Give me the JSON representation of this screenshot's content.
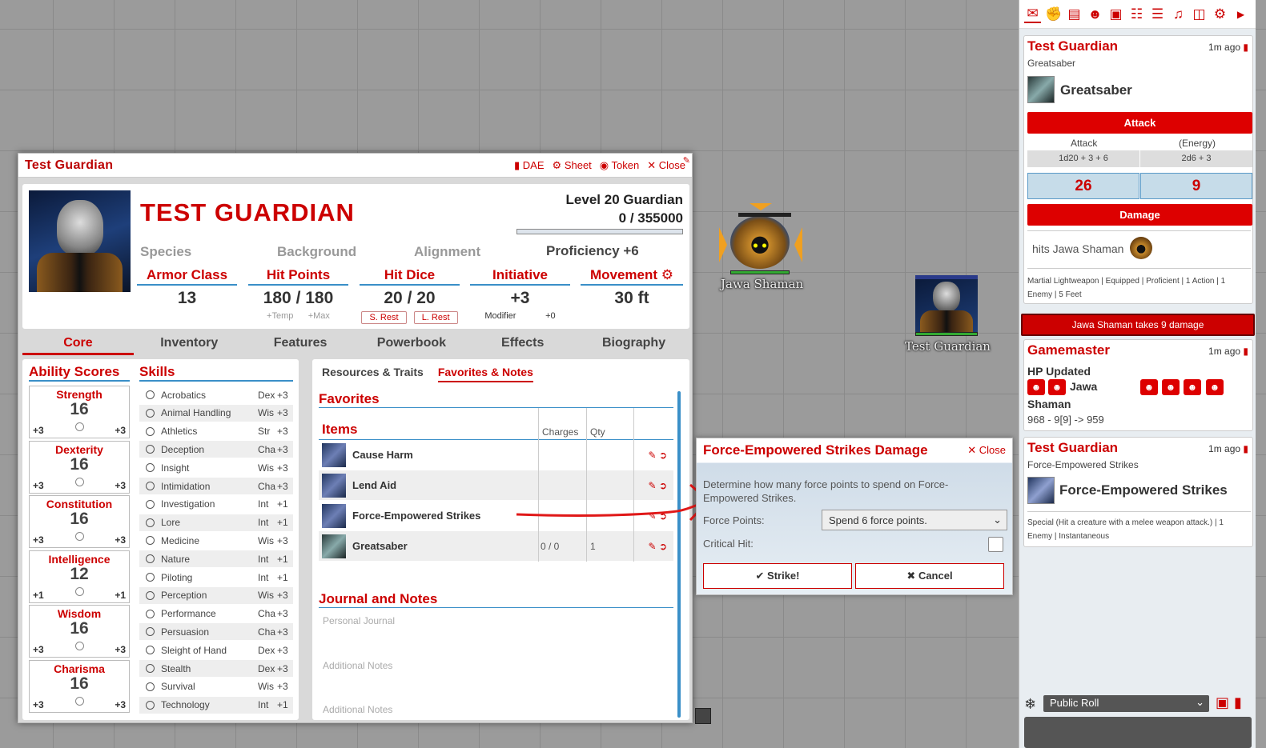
{
  "tokens": {
    "jawa": "Jawa Shaman",
    "guardian": "Test Guardian"
  },
  "sheet": {
    "window_title": "Test Guardian",
    "actions": [
      "DAE",
      "Sheet",
      "Token",
      "Close"
    ],
    "name": "TEST GUARDIAN",
    "level": "Level 20 Guardian",
    "xp": "0  / 355000",
    "species": "Species",
    "background": "Background",
    "alignment": "Alignment",
    "proficiency": "Proficiency +6",
    "stats": {
      "ac": {
        "label": "Armor Class",
        "value": "13"
      },
      "hp": {
        "label": "Hit Points",
        "value": "180 / 180",
        "temp": "+Temp",
        "max": "+Max"
      },
      "hd": {
        "label": "Hit Dice",
        "value": "20 / 20",
        "srest": "S. Rest",
        "lrest": "L. Rest"
      },
      "init": {
        "label": "Initiative",
        "value": "+3",
        "modlabel": "Modifier",
        "mod": "+0"
      },
      "move": {
        "label": "Movement",
        "value": "30 ft"
      }
    },
    "tabs": [
      "Core",
      "Inventory",
      "Features",
      "Powerbook",
      "Effects",
      "Biography"
    ],
    "ability_header": "Ability Scores",
    "skills_header": "Skills",
    "abilities": [
      {
        "name": "Strength",
        "score": "16",
        "mod": "+3",
        "save": "+3"
      },
      {
        "name": "Dexterity",
        "score": "16",
        "mod": "+3",
        "save": "+3"
      },
      {
        "name": "Constitution",
        "score": "16",
        "mod": "+3",
        "save": "+3"
      },
      {
        "name": "Intelligence",
        "score": "12",
        "mod": "+1",
        "save": "+1"
      },
      {
        "name": "Wisdom",
        "score": "16",
        "mod": "+3",
        "save": "+3"
      },
      {
        "name": "Charisma",
        "score": "16",
        "mod": "+3",
        "save": "+3"
      }
    ],
    "skills": [
      {
        "n": "Acrobatics",
        "a": "Dex",
        "b": "+3"
      },
      {
        "n": "Animal Handling",
        "a": "Wis",
        "b": "+3"
      },
      {
        "n": "Athletics",
        "a": "Str",
        "b": "+3"
      },
      {
        "n": "Deception",
        "a": "Cha",
        "b": "+3"
      },
      {
        "n": "Insight",
        "a": "Wis",
        "b": "+3"
      },
      {
        "n": "Intimidation",
        "a": "Cha",
        "b": "+3"
      },
      {
        "n": "Investigation",
        "a": "Int",
        "b": "+1"
      },
      {
        "n": "Lore",
        "a": "Int",
        "b": "+1"
      },
      {
        "n": "Medicine",
        "a": "Wis",
        "b": "+3"
      },
      {
        "n": "Nature",
        "a": "Int",
        "b": "+1"
      },
      {
        "n": "Piloting",
        "a": "Int",
        "b": "+1"
      },
      {
        "n": "Perception",
        "a": "Wis",
        "b": "+3"
      },
      {
        "n": "Performance",
        "a": "Cha",
        "b": "+3"
      },
      {
        "n": "Persuasion",
        "a": "Cha",
        "b": "+3"
      },
      {
        "n": "Sleight of Hand",
        "a": "Dex",
        "b": "+3"
      },
      {
        "n": "Stealth",
        "a": "Dex",
        "b": "+3"
      },
      {
        "n": "Survival",
        "a": "Wis",
        "b": "+3"
      },
      {
        "n": "Technology",
        "a": "Int",
        "b": "+1"
      }
    ],
    "subtabs": [
      "Resources & Traits",
      "Favorites & Notes"
    ],
    "favorites": "Favorites",
    "items_header": "Items",
    "col_charges": "Charges",
    "col_qty": "Qty",
    "items": [
      {
        "name": "Cause Harm",
        "charges": "",
        "qty": ""
      },
      {
        "name": "Lend Aid",
        "charges": "",
        "qty": ""
      },
      {
        "name": "Force-Empowered Strikes",
        "charges": "",
        "qty": ""
      },
      {
        "name": "Greatsaber",
        "charges": "0 / 0",
        "qty": "1"
      }
    ],
    "journal_header": "Journal and Notes",
    "journal": [
      "Personal Journal",
      "Additional Notes",
      "Additional Notes"
    ]
  },
  "dialog": {
    "title": "Force-Empowered Strikes Damage",
    "close": "Close",
    "desc": "Determine how many force points to spend on Force-Empowered Strikes.",
    "fp_label": "Force Points:",
    "fp_value": "Spend 6 force points.",
    "crit_label": "Critical Hit:",
    "strike": "Strike!",
    "cancel": "Cancel"
  },
  "chat": {
    "m1": {
      "speaker": "Test Guardian",
      "time": "1m ago",
      "flavor": "Greatsaber",
      "item": "Greatsaber",
      "attack_btn": "Attack",
      "col1": "Attack",
      "col2": "(Energy)",
      "f1": "1d20 + 3 + 6",
      "f2": "2d6 + 3",
      "r1": "26",
      "r2": "9",
      "damage_btn": "Damage",
      "target": "hits Jawa Shaman",
      "tags": "Martial Lightweapon | Equipped | Proficient | 1 Action | 1 Enemy | 5 Feet"
    },
    "banner": "Jawa Shaman takes 9 damage",
    "m2": {
      "speaker": "Gamemaster",
      "time": "1m ago",
      "title": "HP Updated",
      "who": "Jawa",
      "who2": "Shaman",
      "detail": "968 - 9[9] -> 959"
    },
    "m3": {
      "speaker": "Test Guardian",
      "time": "1m ago",
      "flavor": "Force-Empowered Strikes",
      "item": "Force-Empowered Strikes",
      "tags": "Special (Hit a creature with a melee weapon attack.) | 1 Enemy | Instantaneous"
    },
    "roll_mode": "Public Roll"
  },
  "colors": {
    "accent": "#cc0000",
    "tab_underline": "#3a8fc8"
  }
}
